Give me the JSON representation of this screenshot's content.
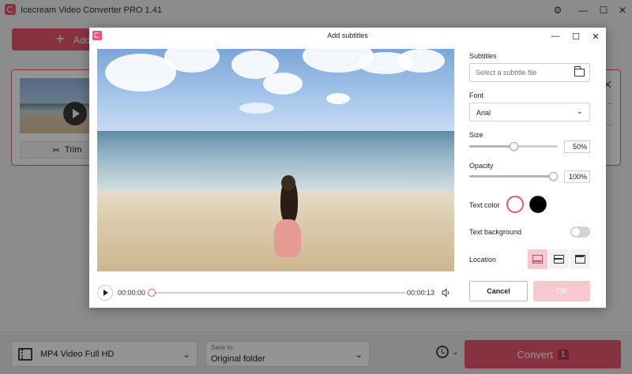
{
  "app": {
    "title": "Icecream Video Converter PRO 1.41",
    "add_files_label": "Add file",
    "trim_label": "Trim",
    "format_label": "MP4 Video Full HD",
    "save_to_caption": "Save to:",
    "save_to_value": "Original folder",
    "convert_label": "Convert",
    "convert_count": "1"
  },
  "dialog": {
    "title": "Add subtitles",
    "player": {
      "current_time": "00:00:00",
      "end_time": "00:00:13",
      "progress": 0
    },
    "subtitles": {
      "label": "Subtitles",
      "placeholder": "Select a subtitle file"
    },
    "font": {
      "label": "Font",
      "value": "Arial"
    },
    "size": {
      "label": "Size",
      "value": "50%",
      "level": 0.5
    },
    "opacity": {
      "label": "Opacity",
      "value": "100%",
      "level": 1.0
    },
    "text_color": {
      "label": "Text color",
      "options": [
        "#ffffff",
        "#000000"
      ],
      "selected": "#ffffff"
    },
    "text_background": {
      "label": "Text background",
      "enabled": false
    },
    "location": {
      "label": "Location",
      "options": [
        "bottom",
        "middle",
        "top"
      ],
      "selected": "bottom"
    },
    "cancel_label": "Cancel",
    "ok_label": "OK"
  },
  "colors": {
    "accent": "#e8566f",
    "accent_light": "#f6c9d0"
  }
}
